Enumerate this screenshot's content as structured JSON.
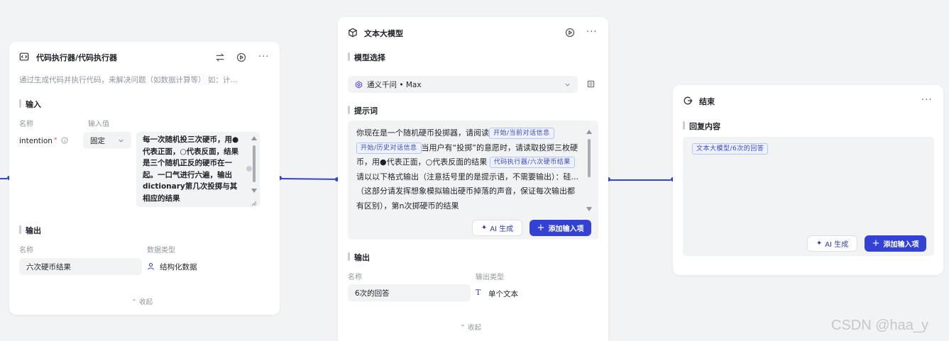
{
  "colors": {
    "accent": "#3342d4",
    "tag_bg": "#eef2ff",
    "canvas": "#f2f3f5"
  },
  "code_node": {
    "title": "代码执行器/代码执行器",
    "description": "通过生成代码并执行代码，来解决问题（如数据计算等） 如：计...",
    "input_section": "输入",
    "col_name": "名称",
    "col_value": "输入值",
    "param_name": "intention",
    "required_mark": "*",
    "param_mode": "固定",
    "param_value": "每一次随机投三次硬币，用●代表正面，○代表反面，结果是三个随机正反的硬币在一起。一口气进行六遍，输出dictionary第几次投掷与其相应的结果",
    "output_section": "输出",
    "out_col_name": "名称",
    "out_col_type": "数据类型",
    "output_name": "六次硬币结果",
    "output_type": "结构化数据",
    "collapse": "收起"
  },
  "llm_node": {
    "title": "文本大模型",
    "model_section": "模型选择",
    "model_value": "通义千问 • Max",
    "prompt_section": "提示词",
    "prompt_seg1": "你现在是一个随机硬币投掷器，请阅读",
    "tag1": "开始/当前对话信息",
    "tag2": "开始/历史对话信息",
    "prompt_seg2": "当用户有“投掷”的意愿时，请读取投掷三枚硬币，用●代表正面，○代表反面的结果",
    "tag3": "代码执行器/六次硬币结果",
    "prompt_seg3": "请以以下格式输出（注意括号里的是提示语，不需要输出）：硅...（这部分请发挥想象模拟输出硬币掉落的声音，保证每次输出都有区别），第n次掷硬币的结果",
    "ai_button": "AI 生成",
    "add_button": "添加输入项",
    "output_section": "输出",
    "out_col_name": "名称",
    "out_col_type": "输出类型",
    "output_name": "6次的回答",
    "output_type": "单个文本",
    "collapse": "收起"
  },
  "end_node": {
    "title": "结束",
    "reply_section": "回复内容",
    "reply_tag": "文本大模型/6次的回答",
    "ai_button": "AI 生成",
    "add_button": "添加输入项"
  },
  "watermark": "CSDN @haa_y"
}
